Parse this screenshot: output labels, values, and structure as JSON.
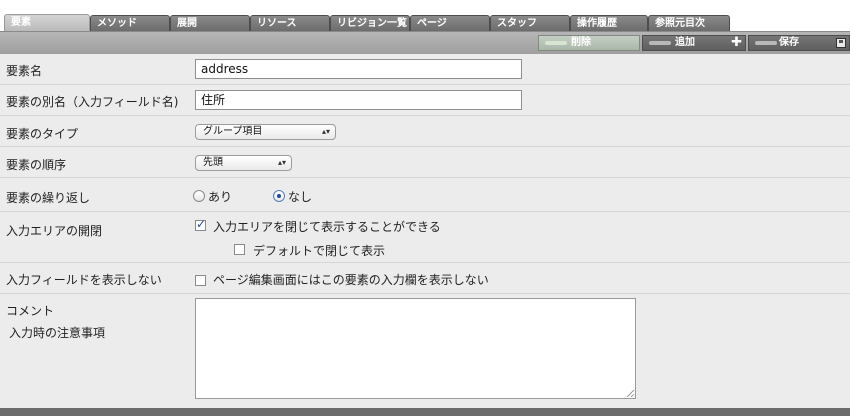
{
  "tabs": [
    {
      "label": "要素",
      "active": true
    },
    {
      "label": "メソッド"
    },
    {
      "label": "展開"
    },
    {
      "label": "リソース"
    },
    {
      "label": "リビジョン一覧"
    },
    {
      "label": "ページ"
    },
    {
      "label": "スタッフ"
    },
    {
      "label": "操作履歴"
    },
    {
      "label": "参照元目次"
    }
  ],
  "toolbar": {
    "delete_label": "削除",
    "add_label": "追加",
    "save_label": "保存",
    "add_icon": "plus-icon",
    "save_icon": "floppy-disk-icon"
  },
  "form": {
    "element_name": {
      "label": "要素名",
      "value": "address"
    },
    "element_alias": {
      "label": "要素の別名（入力フィールド名)",
      "value": "住所"
    },
    "element_type": {
      "label": "要素のタイプ",
      "value": "グループ項目"
    },
    "element_order": {
      "label": "要素の順序",
      "value": "先頭"
    },
    "element_repeat": {
      "label": "要素の繰り返し",
      "options": [
        "あり",
        "なし"
      ],
      "selected": "なし"
    },
    "input_area": {
      "label": "入力エリアの開閉",
      "option1": {
        "text": "入力エリアを閉じて表示することができる",
        "checked": true
      },
      "option2": {
        "text": "デフォルトで閉じて表示",
        "checked": false
      }
    },
    "hide_field": {
      "label": "入力フィールドを表示しない",
      "option": {
        "text": "ページ編集画面にはこの要素の入力欄を表示しない",
        "checked": false
      }
    },
    "comment": {
      "label": "コメント",
      "sublabel": "入力時の注意事項",
      "value": ""
    }
  },
  "colors": {
    "tab_active": "#c8c8c8",
    "tab_inactive": "#7a7a7a",
    "toolbar": "#aaaaaa",
    "form_background": "#ececec"
  }
}
